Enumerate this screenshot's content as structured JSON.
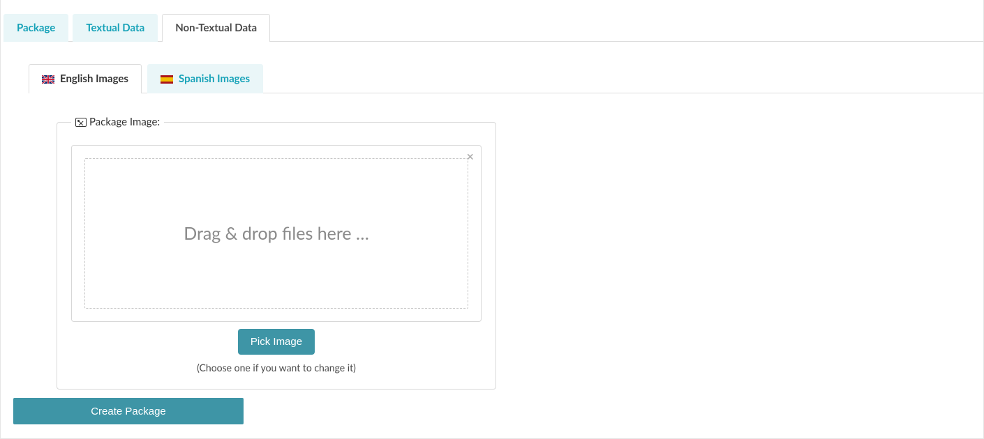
{
  "topTabs": {
    "package": "Package",
    "textual": "Textual Data",
    "nonTextual": "Non-Textual Data"
  },
  "langTabs": {
    "english": "English Images",
    "spanish": "Spanish Images"
  },
  "packageImage": {
    "legend": "Package Image:",
    "dropText": "Drag & drop files here …",
    "pickButton": "Pick Image",
    "hint": "(Choose one if you want to change it)"
  },
  "actions": {
    "create": "Create Package"
  }
}
